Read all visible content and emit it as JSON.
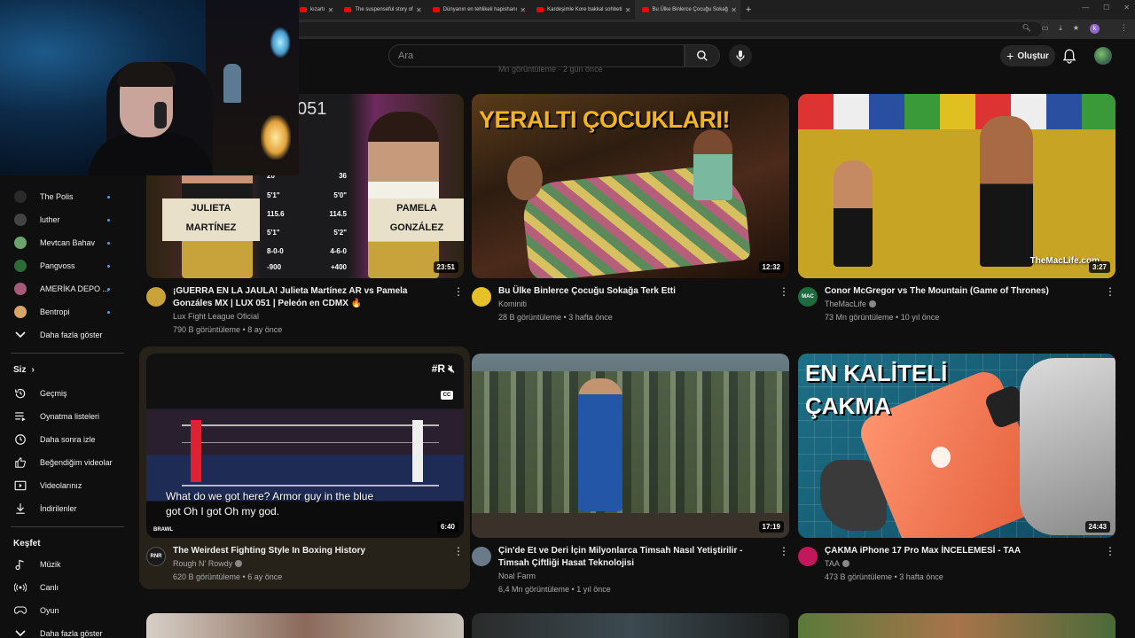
{
  "browser": {
    "tabs": [
      {
        "label": "kızartı"
      },
      {
        "label": "The suspenseful story of"
      },
      {
        "label": "Dünyanın en tehlikeli hapishanı"
      },
      {
        "label": "Kardeşimle Kore bakkal sohbeti"
      },
      {
        "label": "Bu Ülke Binlerce Çocuğu Sokağ"
      }
    ],
    "profile_initial": "k"
  },
  "header": {
    "search_placeholder": "Ara",
    "create_label": "Oluştur",
    "behind_text": "Mn görüntüleme · 2 gün önce"
  },
  "sidebar": {
    "subscriptions": [
      {
        "name": "The Polis",
        "color": "#2a2a2a"
      },
      {
        "name": "luther",
        "color": "#444"
      },
      {
        "name": "Mevtcan Bahav",
        "color": "#6aa36b"
      },
      {
        "name": "Pangvoss",
        "color": "#2e6b3a"
      },
      {
        "name": "AMERİKA DEPO ...",
        "color": "#a55a7a"
      },
      {
        "name": "Bentropi",
        "color": "#d8a46a"
      }
    ],
    "show_more_1": "Daha fazla göster",
    "you_heading": "Siz",
    "you_items": [
      {
        "label": "Geçmiş",
        "icon": "history-icon"
      },
      {
        "label": "Oynatma listeleri",
        "icon": "playlist-icon"
      },
      {
        "label": "Daha sonra izle",
        "icon": "watch-later-icon"
      },
      {
        "label": "Beğendiğim videolar",
        "icon": "like-icon"
      },
      {
        "label": "Videolarınız",
        "icon": "your-videos-icon"
      },
      {
        "label": "İndirilenler",
        "icon": "download-icon"
      }
    ],
    "explore_heading": "Keşfet",
    "explore_items": [
      {
        "label": "Müzik",
        "icon": "music-icon"
      },
      {
        "label": "Canlı",
        "icon": "live-icon"
      },
      {
        "label": "Oyun",
        "icon": "gaming-icon"
      }
    ],
    "show_more_2": "Daha fazla göster"
  },
  "videos": [
    {
      "title": "¡GUERRA EN LA JAULA! Julieta Martínez AR vs Pamela Gonzáles MX | LUX 051 | Peleón en CDMX 🔥",
      "channel": "Lux Fight League Oficial",
      "stats": "790 B görüntüleme • 8 ay önce",
      "duration": "23:51",
      "verified": false,
      "avatar_color": "#c9a23a",
      "thumb": {
        "logo": "051",
        "name_left": [
          "JULIETA",
          "MARTÍNEZ"
        ],
        "name_right": [
          "PAMELA",
          "GONZÁLEZ"
        ],
        "stats_rows": [
          [
            "20",
            "36"
          ],
          [
            "5'1\"",
            "5'0\""
          ],
          [
            "115.6",
            "114.5"
          ],
          [
            "5'1\"",
            "5'2\""
          ],
          [
            "8-0-0",
            "4-6-0"
          ],
          [
            "-900",
            "+400"
          ]
        ]
      }
    },
    {
      "title": "Bu Ülke Binlerce Çocuğu Sokağa Terk Etti",
      "channel": "Kominiti",
      "stats": "28 B görüntüleme • 3 hafta önce",
      "duration": "12:32",
      "verified": false,
      "avatar_color": "#e6c229",
      "thumb": {
        "headline": "YERALTI ÇOCUKLARI!"
      }
    },
    {
      "title": "Conor McGregor vs The Mountain (Game of Thrones)",
      "channel": "TheMacLife",
      "stats": "73 Mn görüntüleme • 10 yıl önce",
      "duration": "3:27",
      "verified": true,
      "avatar_color": "#1d6b3f",
      "avatar_text": "MAC",
      "thumb": {
        "watermark": "TheMacLife.com"
      }
    },
    {
      "title": "The Weirdest Fighting Style In Boxing History",
      "channel": "Rough N' Rowdy",
      "stats": "620 B görüntüleme • 6 ay önce",
      "duration": "6:40",
      "verified": true,
      "avatar_color": "#1a1a1a",
      "avatar_text": "RNR",
      "thumb": {
        "caption": "What do we got here? Armor guy in the blue got Oh I got Oh my god.",
        "cc": "CC",
        "mark": "#R",
        "brand": "BRAWL"
      }
    },
    {
      "title": "Çin'de Et ve Deri İçin Milyonlarca Timsah Nasıl Yetiştirilir - Timsah Çiftliği Hasat Teknolojisi",
      "channel": "Noal Farm",
      "stats": "6,4 Mn görüntüleme • 1 yıl önce",
      "duration": "17:19",
      "verified": false,
      "avatar_color": "#6b7a8a"
    },
    {
      "title": "ÇAKMA iPhone 17 Pro Max İNCELEMESİ - TAA",
      "channel": "TAA",
      "stats": "473 B görüntüleme • 3 hafta önce",
      "duration": "24:43",
      "verified": true,
      "avatar_color": "#c2185b",
      "thumb": {
        "headline_lines": [
          "EN KALİTELİ",
          "ÇAKMA"
        ]
      }
    }
  ]
}
